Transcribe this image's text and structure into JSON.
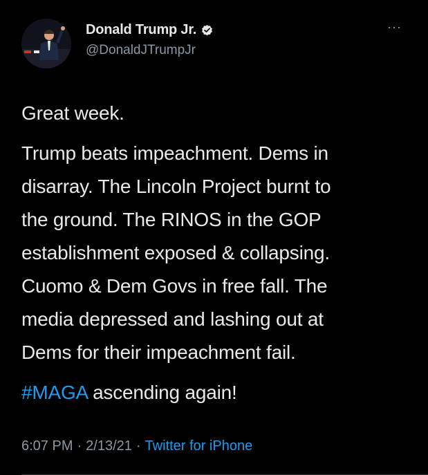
{
  "author": {
    "display_name": "Donald Trump Jr.",
    "handle": "@DonaldJTrumpJr",
    "verified": true
  },
  "more_menu": "···",
  "tweet": {
    "paragraph1": "Great week.",
    "paragraph2_lines": [
      "Trump beats impeachment. Dems in",
      "disarray. The Lincoln Project burnt to",
      "the ground. The RINOS in the GOP",
      "establishment exposed & collapsing.",
      "Cuomo & Dem Govs in free fall. The",
      "media depressed and lashing out at",
      "Dems for their impeachment fail."
    ],
    "hashtag": "#MAGA",
    "paragraph3_rest": " ascending again!"
  },
  "meta": {
    "time": "6:07 PM",
    "date": "2/13/21",
    "separator": "·",
    "source": "Twitter for iPhone"
  },
  "colors": {
    "background": "#000000",
    "text": "#e7e9ea",
    "secondary": "#8b98a5",
    "link": "#1d9bf0"
  }
}
